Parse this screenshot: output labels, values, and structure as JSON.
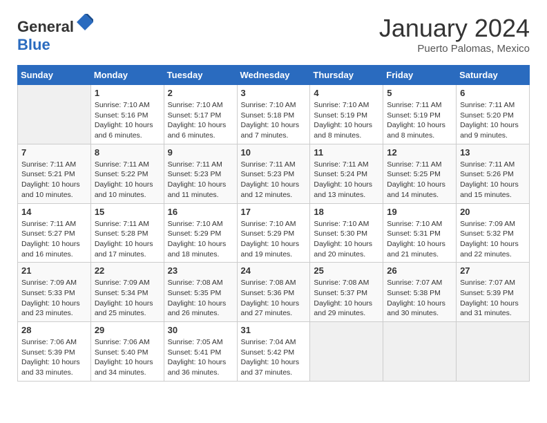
{
  "header": {
    "logo_general": "General",
    "logo_blue": "Blue",
    "month": "January 2024",
    "location": "Puerto Palomas, Mexico"
  },
  "days_of_week": [
    "Sunday",
    "Monday",
    "Tuesday",
    "Wednesday",
    "Thursday",
    "Friday",
    "Saturday"
  ],
  "weeks": [
    [
      {
        "num": "",
        "empty": true
      },
      {
        "num": "1",
        "sunrise": "7:10 AM",
        "sunset": "5:16 PM",
        "daylight": "10 hours and 6 minutes."
      },
      {
        "num": "2",
        "sunrise": "7:10 AM",
        "sunset": "5:17 PM",
        "daylight": "10 hours and 6 minutes."
      },
      {
        "num": "3",
        "sunrise": "7:10 AM",
        "sunset": "5:18 PM",
        "daylight": "10 hours and 7 minutes."
      },
      {
        "num": "4",
        "sunrise": "7:10 AM",
        "sunset": "5:19 PM",
        "daylight": "10 hours and 8 minutes."
      },
      {
        "num": "5",
        "sunrise": "7:11 AM",
        "sunset": "5:19 PM",
        "daylight": "10 hours and 8 minutes."
      },
      {
        "num": "6",
        "sunrise": "7:11 AM",
        "sunset": "5:20 PM",
        "daylight": "10 hours and 9 minutes."
      }
    ],
    [
      {
        "num": "7",
        "sunrise": "7:11 AM",
        "sunset": "5:21 PM",
        "daylight": "10 hours and 10 minutes."
      },
      {
        "num": "8",
        "sunrise": "7:11 AM",
        "sunset": "5:22 PM",
        "daylight": "10 hours and 10 minutes."
      },
      {
        "num": "9",
        "sunrise": "7:11 AM",
        "sunset": "5:23 PM",
        "daylight": "10 hours and 11 minutes."
      },
      {
        "num": "10",
        "sunrise": "7:11 AM",
        "sunset": "5:23 PM",
        "daylight": "10 hours and 12 minutes."
      },
      {
        "num": "11",
        "sunrise": "7:11 AM",
        "sunset": "5:24 PM",
        "daylight": "10 hours and 13 minutes."
      },
      {
        "num": "12",
        "sunrise": "7:11 AM",
        "sunset": "5:25 PM",
        "daylight": "10 hours and 14 minutes."
      },
      {
        "num": "13",
        "sunrise": "7:11 AM",
        "sunset": "5:26 PM",
        "daylight": "10 hours and 15 minutes."
      }
    ],
    [
      {
        "num": "14",
        "sunrise": "7:11 AM",
        "sunset": "5:27 PM",
        "daylight": "10 hours and 16 minutes."
      },
      {
        "num": "15",
        "sunrise": "7:11 AM",
        "sunset": "5:28 PM",
        "daylight": "10 hours and 17 minutes."
      },
      {
        "num": "16",
        "sunrise": "7:10 AM",
        "sunset": "5:29 PM",
        "daylight": "10 hours and 18 minutes."
      },
      {
        "num": "17",
        "sunrise": "7:10 AM",
        "sunset": "5:29 PM",
        "daylight": "10 hours and 19 minutes."
      },
      {
        "num": "18",
        "sunrise": "7:10 AM",
        "sunset": "5:30 PM",
        "daylight": "10 hours and 20 minutes."
      },
      {
        "num": "19",
        "sunrise": "7:10 AM",
        "sunset": "5:31 PM",
        "daylight": "10 hours and 21 minutes."
      },
      {
        "num": "20",
        "sunrise": "7:09 AM",
        "sunset": "5:32 PM",
        "daylight": "10 hours and 22 minutes."
      }
    ],
    [
      {
        "num": "21",
        "sunrise": "7:09 AM",
        "sunset": "5:33 PM",
        "daylight": "10 hours and 23 minutes."
      },
      {
        "num": "22",
        "sunrise": "7:09 AM",
        "sunset": "5:34 PM",
        "daylight": "10 hours and 25 minutes."
      },
      {
        "num": "23",
        "sunrise": "7:08 AM",
        "sunset": "5:35 PM",
        "daylight": "10 hours and 26 minutes."
      },
      {
        "num": "24",
        "sunrise": "7:08 AM",
        "sunset": "5:36 PM",
        "daylight": "10 hours and 27 minutes."
      },
      {
        "num": "25",
        "sunrise": "7:08 AM",
        "sunset": "5:37 PM",
        "daylight": "10 hours and 29 minutes."
      },
      {
        "num": "26",
        "sunrise": "7:07 AM",
        "sunset": "5:38 PM",
        "daylight": "10 hours and 30 minutes."
      },
      {
        "num": "27",
        "sunrise": "7:07 AM",
        "sunset": "5:39 PM",
        "daylight": "10 hours and 31 minutes."
      }
    ],
    [
      {
        "num": "28",
        "sunrise": "7:06 AM",
        "sunset": "5:39 PM",
        "daylight": "10 hours and 33 minutes."
      },
      {
        "num": "29",
        "sunrise": "7:06 AM",
        "sunset": "5:40 PM",
        "daylight": "10 hours and 34 minutes."
      },
      {
        "num": "30",
        "sunrise": "7:05 AM",
        "sunset": "5:41 PM",
        "daylight": "10 hours and 36 minutes."
      },
      {
        "num": "31",
        "sunrise": "7:04 AM",
        "sunset": "5:42 PM",
        "daylight": "10 hours and 37 minutes."
      },
      {
        "num": "",
        "empty": true
      },
      {
        "num": "",
        "empty": true
      },
      {
        "num": "",
        "empty": true
      }
    ]
  ],
  "labels": {
    "sunrise": "Sunrise:",
    "sunset": "Sunset:",
    "daylight": "Daylight:"
  }
}
